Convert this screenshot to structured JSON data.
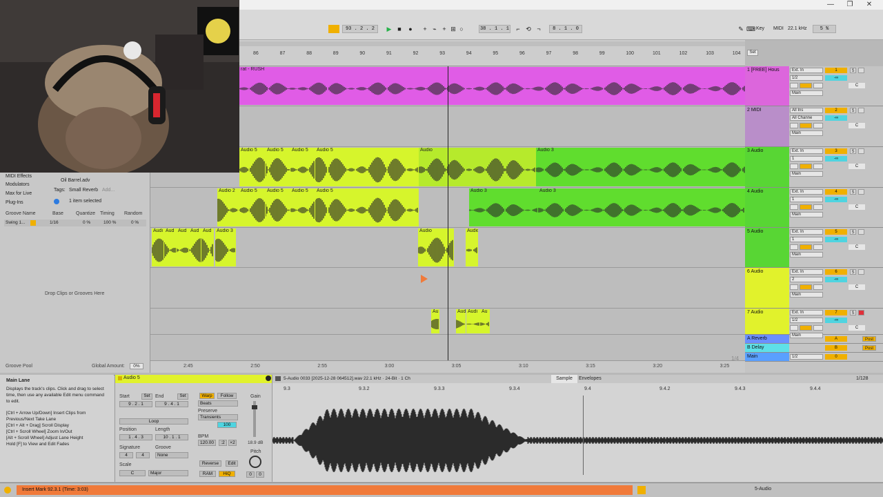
{
  "window": {
    "minimize": "—",
    "restore": "❐",
    "close": "✕"
  },
  "transport": {
    "arrangement_position": "93 . 2 . 2",
    "loop_start": "38 . 1 . 1",
    "loop_length": "8 . 1 . 0",
    "key_label": "Key",
    "midi_label": "MIDI",
    "sample_rate": "22.1 kHz",
    "cpu": "5 %"
  },
  "ruler": {
    "bars": [
      "86",
      "87",
      "88",
      "89",
      "90",
      "91",
      "92",
      "93",
      "94",
      "95",
      "96",
      "97",
      "98",
      "99",
      "100",
      "101",
      "102",
      "103",
      "104"
    ],
    "set_label": "Set"
  },
  "time_ruler": {
    "times": [
      "2:45",
      "2:50",
      "2:55",
      "3:00",
      "3:05",
      "3:10",
      "3:15",
      "3:20",
      "3:25"
    ],
    "zoom_label": "1/4"
  },
  "tracks": [
    {
      "name": "1 [FREE] Hous",
      "input": "Ext. In",
      "channel": "1/2",
      "output": "Main",
      "number": "1",
      "color": "#e05ce6",
      "header_color": "#dc66dc",
      "clip_label": "rat - RUSH",
      "vol": "-∞",
      "pan": "C"
    },
    {
      "name": "2 MIDI",
      "input": "All Ins",
      "channel": "All Channe",
      "output": "Main",
      "number": "2",
      "color": "#b592c9",
      "header_color": "#b98ec9",
      "vol": "-∞",
      "pan": "C"
    },
    {
      "name": "3 Audio",
      "input": "Ext. In",
      "channel": "1",
      "output": "Main",
      "number": "3",
      "color": "#60dd2e",
      "header_color": "#58d634",
      "clip_labels": [
        "Audio 5",
        "Audio 5",
        "Audio 5",
        "Audio 5",
        "Audio",
        "Audio 3"
      ],
      "vol": "-∞",
      "pan": "C"
    },
    {
      "name": "4 Audio",
      "input": "Ext. In",
      "channel": "1",
      "output": "Main",
      "number": "4",
      "color": "#60dd2e",
      "header_color": "#58d634",
      "clip_labels": [
        "Audio 2",
        "Audio 5",
        "Audio 5",
        "Audio 5",
        "Audio 5",
        "Audio 3",
        "Audio 3"
      ],
      "vol": "-∞",
      "pan": "C"
    },
    {
      "name": "5 Audio",
      "input": "Ext. In",
      "channel": "1",
      "output": "Main",
      "number": "5",
      "color": "#60dd2e",
      "header_color": "#58d634",
      "clip_labels": [
        "Audi",
        "Aud",
        "Aud",
        "Aud",
        "Aud",
        "Audio 3",
        "Audio",
        "Audio"
      ],
      "vol": "-∞",
      "pan": "C"
    },
    {
      "name": "6 Audio",
      "input": "Ext. In",
      "channel": "2",
      "output": "Main",
      "number": "6",
      "color": "#e1f22c",
      "header_color": "#e1f22c",
      "vol": "-∞",
      "pan": "C"
    },
    {
      "name": "7 Audio",
      "input": "Ext. In",
      "channel": "1/2",
      "output": "Main",
      "number": "7",
      "color": "#e1f22c",
      "header_color": "#e1f22c",
      "clip_labels": [
        "Au",
        "Audi",
        "Audi",
        "Au"
      ],
      "vol": "-∞",
      "pan": "C"
    }
  ],
  "returns": [
    {
      "name": "A Reverb",
      "letter": "A",
      "send": "Post"
    },
    {
      "name": "B Delay",
      "letter": "B",
      "send": "Post"
    },
    {
      "name": "Main",
      "letter": "0",
      "channel": "1/2"
    }
  ],
  "browser": {
    "items": [
      "MIDI Effects",
      "Modulators",
      "Max for Live",
      "Plug-Ins"
    ],
    "file": "Oil Barrel.adv",
    "tags_label": "Tags:",
    "tag": "Small Reverb",
    "add": "Add...",
    "selection": "1 item selected"
  },
  "groove_pool": {
    "headers": [
      "Groove Name",
      "Base",
      "Quantize",
      "Timing",
      "Random"
    ],
    "row": {
      "name": "Swing 1...",
      "base": "1/16",
      "quantize": "0 %",
      "timing": "100 %",
      "random": "0 %"
    },
    "drop_hint": "Drop Clips or Grooves Here",
    "footer": "Groove Pool",
    "global_label": "Global Amount:",
    "global_value": "0%"
  },
  "info": {
    "title": "Main Lane",
    "lines": [
      "Displays the track's clips. Click and drag to select time, then use any available Edit menu command to edit.",
      "[Ctrl + Arrow Up/Down] Insert Clips from Previous/Next Take Lane",
      "[Ctrl + Alt + Drag] Scroll Display",
      "[Ctrl + Scroll Wheel] Zoom In/Out",
      "[Alt + Scroll Wheel] Adjust Lane Height",
      "Hold [F] to View and Edit Fades"
    ]
  },
  "clip_view": {
    "clip_name": "Audio 5",
    "start_label": "Start",
    "end_label": "End",
    "set_label": "Set",
    "start_value": "9 . 2 . 1",
    "end_value": "9 . 4 . 1",
    "loop_label": "Loop",
    "position_label": "Position",
    "length_label": "Length",
    "position_value": "1 . 4 . 3",
    "length_value": "10 . 1 . 1",
    "signature_label": "Signature",
    "groove_label": "Groove",
    "sig_num": "4",
    "sig_den": "4",
    "groove_value": "None",
    "scale_label": "Scale",
    "scale_root": "C",
    "scale_mode": "Major",
    "warp_label": "Warp",
    "follow_label": "Follow",
    "warp_mode": "Beats",
    "preserve_label": "Preserve",
    "preserve_value": "Transients",
    "loop_amount": "100",
    "bpm_label": "BPM",
    "bpm_value": "120.00",
    "half_label": ":2",
    "double_label": "×2",
    "reverse_label": "Reverse",
    "edit_label": "Edit",
    "ram_label": "RAM",
    "hiq_label": "HiQ",
    "gain_label": "Gain",
    "gain_value": "18.9 dB",
    "pitch_label": "Pitch",
    "pitch_st": "0",
    "pitch_cents": "0"
  },
  "sample_editor": {
    "file_info": "5-Audio 0033 [2025-12-28 064512].wav  22.1 kHz · 24-Bit · 1 Ch",
    "sample_tab": "Sample",
    "envelopes_tab": "Envelopes",
    "quantize": "1/128",
    "markers": [
      "9.3",
      "9.3.2",
      "9.3.3",
      "9.3.4",
      "9.4",
      "9.4.2",
      "9.4.3",
      "9.4.4"
    ]
  },
  "status": {
    "message": "Insert Mark 92.3.1 (Time: 3:03)",
    "track": "5-Audio"
  }
}
